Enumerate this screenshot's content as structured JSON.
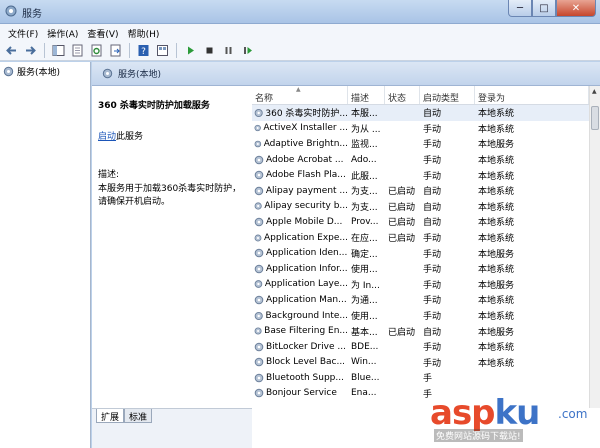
{
  "window": {
    "title": "服务",
    "buttons": {
      "minimize": "─",
      "maximize": "□",
      "close": "✕"
    }
  },
  "menu": [
    "文件(F)",
    "操作(A)",
    "查看(V)",
    "帮助(H)"
  ],
  "toolbar": [
    "back-arrow-icon",
    "forward-arrow-icon",
    "show-tree-icon",
    "properties-icon",
    "refresh-icon",
    "export-icon",
    "help-icon",
    "console-icon",
    "play-icon",
    "stop-icon",
    "pause-icon",
    "restart-icon"
  ],
  "tree": {
    "node_label": "服务(本地)"
  },
  "pane": {
    "header_label": "服务(本地)"
  },
  "description": {
    "service_title": "360 杀毒实时防护加载服务",
    "action_link": "启动",
    "action_suffix": "此服务",
    "label": "描述:",
    "body": "本服务用于加载360杀毒实时防护，请确保开机启动。"
  },
  "table": {
    "columns": [
      "名称",
      "描述",
      "状态",
      "启动类型",
      "登录为"
    ],
    "rows": [
      {
        "name": "360 杀毒实时防护...",
        "desc": "本服...",
        "status": "",
        "start": "自动",
        "logon": "本地系统",
        "selected": true
      },
      {
        "name": "ActiveX Installer ...",
        "desc": "为从 ...",
        "status": "",
        "start": "手动",
        "logon": "本地系统"
      },
      {
        "name": "Adaptive Brightn...",
        "desc": "监视...",
        "status": "",
        "start": "手动",
        "logon": "本地服务"
      },
      {
        "name": "Adobe Acrobat ...",
        "desc": "Ado...",
        "status": "",
        "start": "手动",
        "logon": "本地系统"
      },
      {
        "name": "Adobe Flash Pla...",
        "desc": "此服...",
        "status": "",
        "start": "手动",
        "logon": "本地系统"
      },
      {
        "name": "Alipay payment ...",
        "desc": "为支...",
        "status": "已启动",
        "start": "自动",
        "logon": "本地系统"
      },
      {
        "name": "Alipay security b...",
        "desc": "为支...",
        "status": "已启动",
        "start": "自动",
        "logon": "本地系统"
      },
      {
        "name": "Apple Mobile D...",
        "desc": "Prov...",
        "status": "已启动",
        "start": "自动",
        "logon": "本地系统"
      },
      {
        "name": "Application Expe...",
        "desc": "在应...",
        "status": "已启动",
        "start": "手动",
        "logon": "本地系统"
      },
      {
        "name": "Application Iden...",
        "desc": "确定...",
        "status": "",
        "start": "手动",
        "logon": "本地服务"
      },
      {
        "name": "Application Infor...",
        "desc": "使用...",
        "status": "",
        "start": "手动",
        "logon": "本地系统"
      },
      {
        "name": "Application Laye...",
        "desc": "为 In...",
        "status": "",
        "start": "手动",
        "logon": "本地服务"
      },
      {
        "name": "Application Man...",
        "desc": "为通...",
        "status": "",
        "start": "手动",
        "logon": "本地系统"
      },
      {
        "name": "Background Inte...",
        "desc": "使用...",
        "status": "",
        "start": "手动",
        "logon": "本地系统"
      },
      {
        "name": "Base Filtering En...",
        "desc": "基本...",
        "status": "已启动",
        "start": "自动",
        "logon": "本地服务"
      },
      {
        "name": "BitLocker Drive ...",
        "desc": "BDE...",
        "status": "",
        "start": "手动",
        "logon": "本地系统"
      },
      {
        "name": "Block Level Bac...",
        "desc": "Win...",
        "status": "",
        "start": "手动",
        "logon": "本地系统"
      },
      {
        "name": "Bluetooth Supp...",
        "desc": "Blue...",
        "status": "",
        "start": "手",
        "logon": ""
      },
      {
        "name": "Bonjour Service",
        "desc": "Ena...",
        "status": "",
        "start": "手",
        "logon": ""
      }
    ]
  },
  "tabs": [
    "扩展",
    "标准"
  ],
  "watermark": {
    "brand_a": "asp",
    "brand_b": "ku",
    "suffix": ".com",
    "sub": "免费网站源码下载站!"
  }
}
